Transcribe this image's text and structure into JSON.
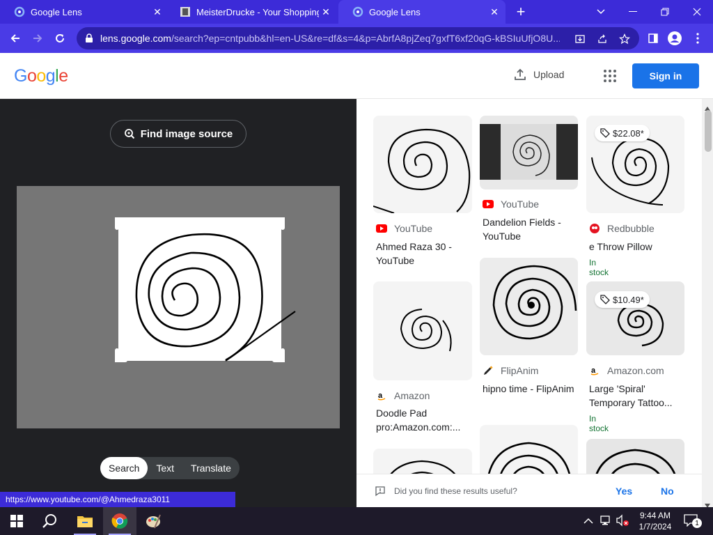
{
  "browser": {
    "tabs": [
      {
        "title": "Google Lens",
        "icon": "google-lens-icon",
        "active": false
      },
      {
        "title": "MeisterDrucke - Your Shopping",
        "icon": "meisterdrucke-icon",
        "active": false
      },
      {
        "title": "Google Lens",
        "icon": "google-lens-icon",
        "active": true
      }
    ],
    "new_tab": "+",
    "url_host": "lens.google.com",
    "url_rest": "/search?ep=cntpubb&hl=en-US&re=df&s=4&p=AbrfA8pjZeq7gxfT6xf20qG-kBSIuUfjO8U...",
    "status_url": "https://www.youtube.com/@Ahmedraza3011"
  },
  "header": {
    "logo": [
      "G",
      "o",
      "o",
      "g",
      "l",
      "e"
    ],
    "upload_label": "Upload",
    "signin_label": "Sign in"
  },
  "left": {
    "find_source": "Find image source",
    "modes": [
      "Search",
      "Text",
      "Translate"
    ],
    "selected_mode": "Search"
  },
  "results": [
    {
      "source": "YouTube",
      "title": "Ahmed Raza 30 - YouTube",
      "icon": "youtube-icon"
    },
    {
      "source": "YouTube",
      "title": "Dandelion Fields - YouTube",
      "icon": "youtube-icon"
    },
    {
      "source": "Redbubble",
      "title": "e Throw Pillow",
      "icon": "redbubble-icon",
      "price": "$22.08*",
      "stock": "In stock"
    },
    {
      "source": "Amazon",
      "title": "Doodle Pad pro:Amazon.com:...",
      "icon": "amazon-icon"
    },
    {
      "source": "FlipAnim",
      "title": "hipno time - FlipAnim",
      "icon": "flipanim-icon"
    },
    {
      "source": "Amazon.com",
      "title": "Large 'Spiral' Temporary Tattoo...",
      "icon": "amazon-icon",
      "price": "$10.49*",
      "stock": "In stock"
    }
  ],
  "feedback": {
    "question": "Did you find these results useful?",
    "yes": "Yes",
    "no": "No"
  },
  "taskbar": {
    "time": "9:44 AM",
    "date": "1/7/2024",
    "notification_count": "1"
  },
  "colors": {
    "tab_bar": "#3c2bd8",
    "toolbar": "#4a3be6",
    "signin": "#1a73e8",
    "left_pane": "#202124"
  }
}
